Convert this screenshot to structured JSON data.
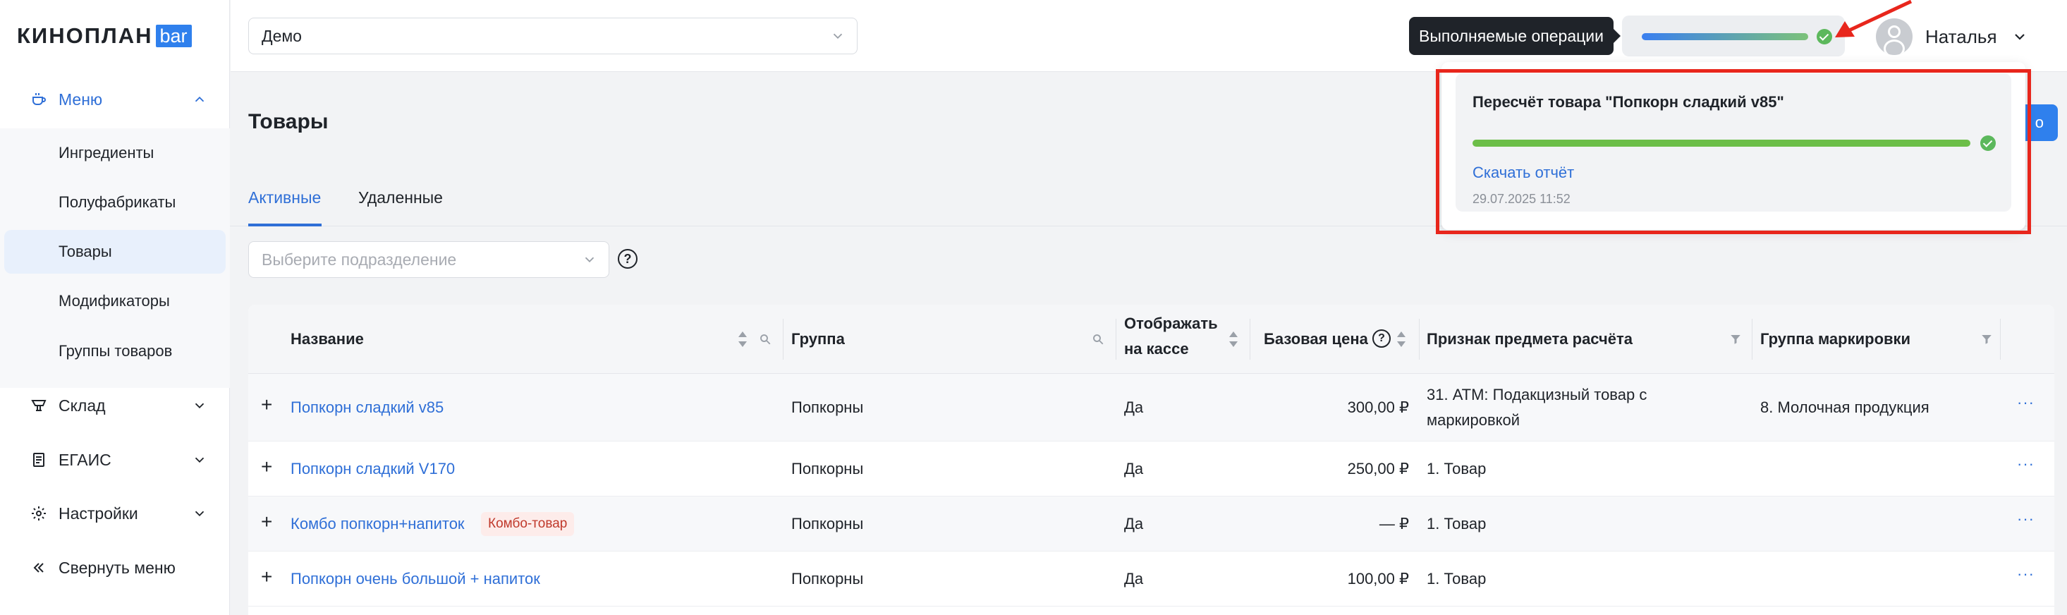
{
  "app": {
    "logo_text": "КИНОПЛАН",
    "logo_badge": "bar"
  },
  "sidebar": {
    "menu": {
      "label": "Меню",
      "icon": "coffee-cup-icon"
    },
    "submenu": [
      {
        "label": "Ингредиенты"
      },
      {
        "label": "Полуфабрикаты"
      },
      {
        "label": "Товары",
        "selected": true
      },
      {
        "label": "Модификаторы"
      },
      {
        "label": "Группы товаров"
      }
    ],
    "groups": [
      {
        "label": "Склад",
        "icon": "cart-icon"
      },
      {
        "label": "ЕГАИС",
        "icon": "document-icon"
      },
      {
        "label": "Настройки",
        "icon": "gear-icon"
      }
    ],
    "collapse_label": "Свернуть меню"
  },
  "topbar": {
    "cinema_select": "Демо",
    "ops_tooltip": "Выполняемые операции",
    "user_name": "Наталья"
  },
  "page": {
    "title": "Товары",
    "create_button": "о",
    "tabs": [
      {
        "label": "Активные",
        "active": true
      },
      {
        "label": "Удаленные",
        "active": false
      }
    ],
    "department_placeholder": "Выберите подразделение",
    "help_symbol": "?"
  },
  "table": {
    "headers": {
      "name": "Название",
      "group": "Группа",
      "show_1": "Отображать",
      "show_2": "на кассе",
      "price": "Базовая цена",
      "subject": "Признак предмета расчёта",
      "marking": "Группа маркировки"
    },
    "rows": [
      {
        "name": "Попкорн сладкий v85",
        "tag": "",
        "group": "Попкорны",
        "show": "Да",
        "price": "300,00 ₽",
        "subject_1": "31. АТМ: Подакцизный товар с",
        "subject_2": "маркировкой",
        "marking": "8. Молочная продукция"
      },
      {
        "name": "Попкорн сладкий V170",
        "tag": "",
        "group": "Попкорны",
        "show": "Да",
        "price": "250,00 ₽",
        "subject_1": "1. Товар",
        "subject_2": "",
        "marking": ""
      },
      {
        "name": "Комбо попкорн+напиток",
        "tag": "Комбо-товар",
        "group": "Попкорны",
        "show": "Да",
        "price": "— ₽",
        "subject_1": "1. Товар",
        "subject_2": "",
        "marking": ""
      },
      {
        "name": "Попкорн очень большой + напиток",
        "tag": "",
        "group": "Попкорны",
        "show": "Да",
        "price": "100,00 ₽",
        "subject_1": "1. Товар",
        "subject_2": "",
        "marking": ""
      }
    ],
    "row_plus": "+",
    "row_menu": "···"
  },
  "notification": {
    "title": "Пересчёт товара \"Попкорн сладкий v85\"",
    "progress": 1.0,
    "download_link": "Скачать отчёт",
    "timestamp": "29.07.2025 11:52",
    "status": "completed"
  },
  "colors": {
    "accent": "#2f6fd7",
    "success": "#5cb85c",
    "highlight": "#e8261c",
    "combo_tag_bg": "#fdecea",
    "combo_tag_text": "#c0392b"
  }
}
